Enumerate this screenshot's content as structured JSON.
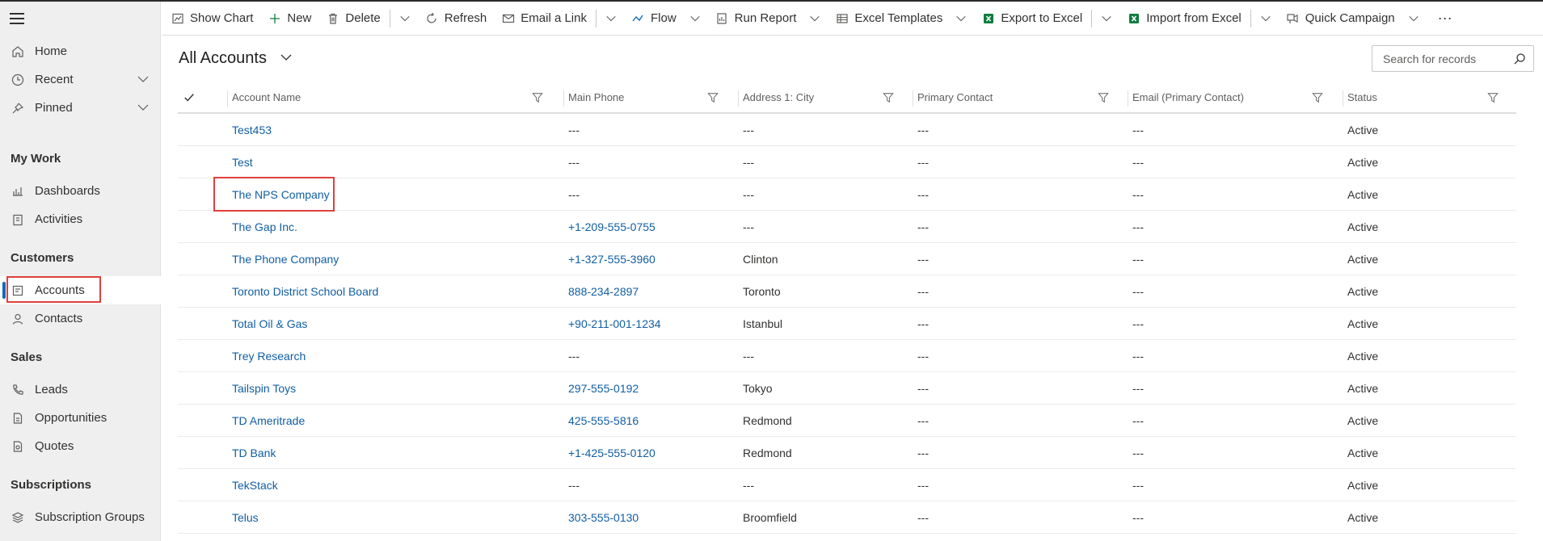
{
  "sidebar": {
    "home": "Home",
    "recent": "Recent",
    "pinned": "Pinned",
    "my_work_title": "My Work",
    "dashboards": "Dashboards",
    "activities": "Activities",
    "customers_title": "Customers",
    "accounts": "Accounts",
    "contacts": "Contacts",
    "sales_title": "Sales",
    "leads": "Leads",
    "opportunities": "Opportunities",
    "quotes": "Quotes",
    "subscriptions_title": "Subscriptions",
    "subscription_groups": "Subscription Groups"
  },
  "toolbar": {
    "show_chart": "Show Chart",
    "new": "New",
    "delete": "Delete",
    "refresh": "Refresh",
    "email_link": "Email a Link",
    "flow": "Flow",
    "run_report": "Run Report",
    "excel_templates": "Excel Templates",
    "export_excel": "Export to Excel",
    "import_excel": "Import from Excel",
    "quick_campaign": "Quick Campaign",
    "more": "···"
  },
  "view": {
    "title": "All Accounts",
    "search_placeholder": "Search for records"
  },
  "columns": [
    "Account Name",
    "Main Phone",
    "Address 1: City",
    "Primary Contact",
    "Email (Primary Contact)",
    "Status"
  ],
  "rows": [
    {
      "name": "Test453",
      "phone": "---",
      "city": "---",
      "contact": "---",
      "email": "---",
      "status": "Active"
    },
    {
      "name": "Test",
      "phone": "---",
      "city": "---",
      "contact": "---",
      "email": "---",
      "status": "Active"
    },
    {
      "name": "The NPS Company",
      "phone": "---",
      "city": "---",
      "contact": "---",
      "email": "---",
      "status": "Active"
    },
    {
      "name": "The Gap Inc.",
      "phone": "+1-209-555-0755",
      "city": "---",
      "contact": "---",
      "email": "---",
      "status": "Active"
    },
    {
      "name": "The Phone Company",
      "phone": "+1-327-555-3960",
      "city": "Clinton",
      "contact": "---",
      "email": "---",
      "status": "Active"
    },
    {
      "name": "Toronto District School Board",
      "phone": "888-234-2897",
      "city": "Toronto",
      "contact": "---",
      "email": "---",
      "status": "Active"
    },
    {
      "name": "Total Oil & Gas",
      "phone": "+90-211-001-1234",
      "city": "Istanbul",
      "contact": "---",
      "email": "---",
      "status": "Active"
    },
    {
      "name": "Trey Research",
      "phone": "---",
      "city": "---",
      "contact": "---",
      "email": "---",
      "status": "Active"
    },
    {
      "name": "Tailspin Toys",
      "phone": "297-555-0192",
      "city": "Tokyo",
      "contact": "---",
      "email": "---",
      "status": "Active"
    },
    {
      "name": "TD Ameritrade",
      "phone": "425-555-5816",
      "city": "Redmond",
      "contact": "---",
      "email": "---",
      "status": "Active"
    },
    {
      "name": "TD Bank",
      "phone": "+1-425-555-0120",
      "city": "Redmond",
      "contact": "---",
      "email": "---",
      "status": "Active"
    },
    {
      "name": "TekStack",
      "phone": "---",
      "city": "---",
      "contact": "---",
      "email": "---",
      "status": "Active"
    },
    {
      "name": "Telus",
      "phone": "303-555-0130",
      "city": "Broomfield",
      "contact": "---",
      "email": "---",
      "status": "Active"
    }
  ],
  "colors": {
    "link": "#115ea3",
    "accent": "#0f6cbd",
    "highlight": "#e0403c",
    "excel_green": "#107c41"
  }
}
